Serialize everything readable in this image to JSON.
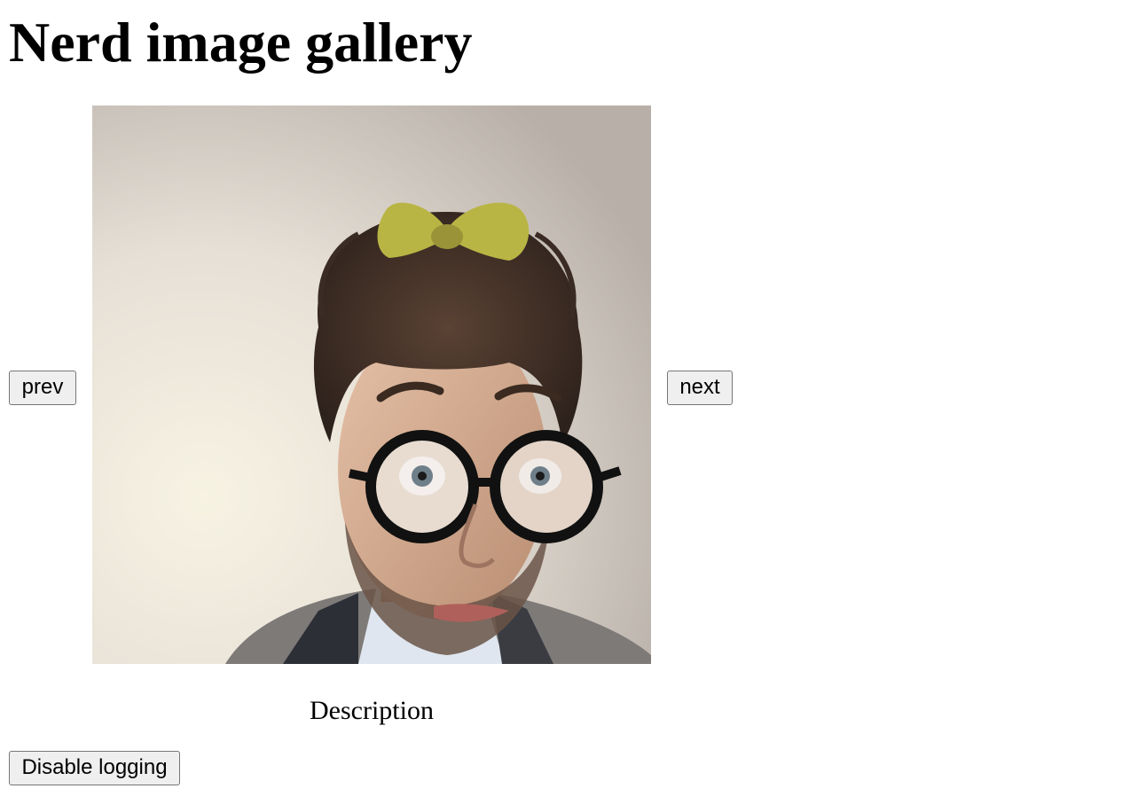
{
  "page": {
    "title": "Nerd image gallery"
  },
  "gallery": {
    "prev_label": "prev",
    "next_label": "next",
    "description": "Description"
  },
  "footer": {
    "logging_button_label": "Disable logging"
  },
  "colors": {
    "background": "#ffffff",
    "button_bg": "#efefef",
    "button_border": "#767676"
  }
}
